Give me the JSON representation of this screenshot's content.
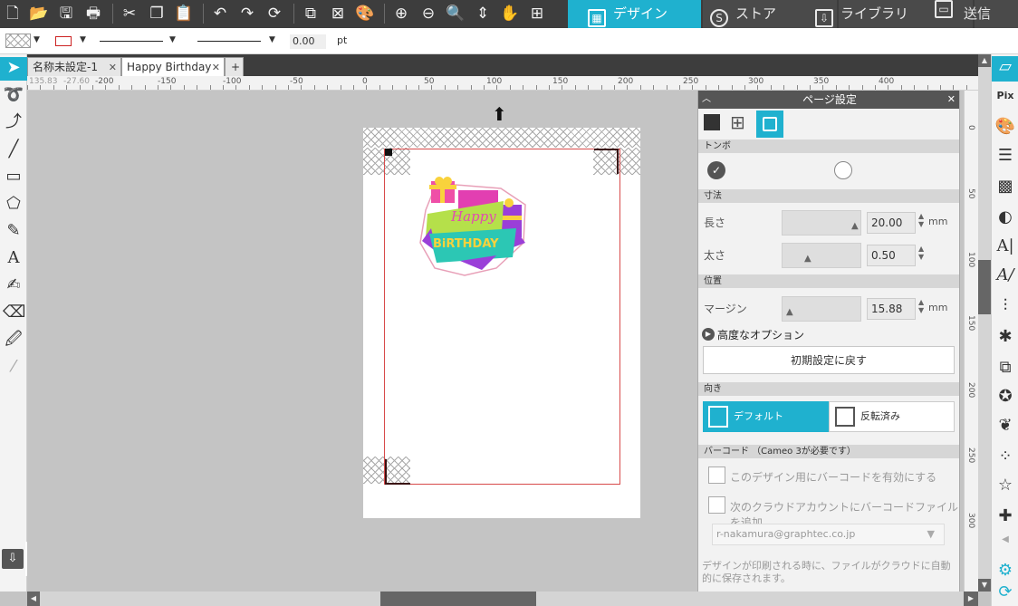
{
  "toolbar": {
    "mode_tabs": [
      {
        "label": "デザイン",
        "active": true
      },
      {
        "label": "ストア",
        "active": false
      },
      {
        "label": "ライブラリ",
        "active": false
      },
      {
        "label": "送信",
        "active": false
      }
    ]
  },
  "quickbar": {
    "line_width_value": "0.00",
    "line_width_unit": "pt"
  },
  "doc_tabs": [
    {
      "label": "名称未設定-1",
      "active": false
    },
    {
      "label": "Happy Birthday",
      "active": true
    }
  ],
  "add_tab_label": "+",
  "ruler": {
    "coords_x": "135.83",
    "coords_y": "-27.60",
    "h_labels": [
      "-200",
      "-150",
      "-100",
      "-50",
      "0",
      "50",
      "100",
      "150",
      "200",
      "250",
      "300",
      "350",
      "400"
    ],
    "v_labels": [
      "0",
      "50",
      "100",
      "150",
      "200",
      "250",
      "300"
    ]
  },
  "design": {
    "text_top": "Happy",
    "text_bottom": "BiRTHDAY"
  },
  "panel": {
    "title": "ページ設定",
    "sections": {
      "tonbo": "トンボ",
      "size": "寸法",
      "position": "位置",
      "orientation": "向き",
      "barcode": "バーコード （Cameo 3が必要です）"
    },
    "length_label": "長さ",
    "length_value": "20.00",
    "length_level": 0.95,
    "thickness_label": "太さ",
    "thickness_value": "0.50",
    "thickness_level": 0.3,
    "margin_label": "マージン",
    "margin_value": "15.88",
    "margin_level": 0.05,
    "unit": "mm",
    "advanced_options": "高度なオプション",
    "reset_button": "初期設定に戻す",
    "orientation_default": "デフォルト",
    "orientation_flipped": "反転済み",
    "barcode_enable": "このデザイン用にバーコードを有効にする",
    "barcode_cloud": "次のクラウドアカウントにバーコードファイルを追加",
    "account": "r-nakamura@graphtec.co.jp",
    "footer_note": "デザインが印刷される時に、ファイルがクラウドに自動的に保存されます。"
  },
  "colors": {
    "accent": "#1fb1cf",
    "toolbar_bg": "#3d3d3d",
    "cut_line": "#d84a4a"
  }
}
